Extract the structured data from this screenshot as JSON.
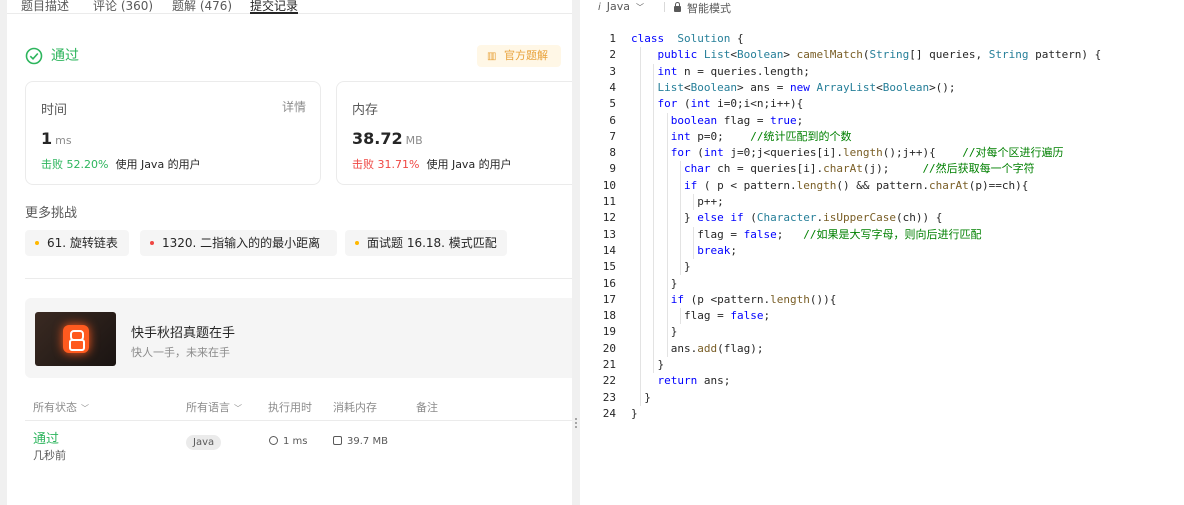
{
  "tabs": [
    {
      "label": "题目描述"
    },
    {
      "label": "评论 (360)"
    },
    {
      "label": "题解 (476)"
    },
    {
      "label": "提交记录"
    }
  ],
  "result": {
    "status": "通过",
    "official_solution": "官方题解",
    "time": {
      "label": "时间",
      "detail": "详情",
      "value": "1",
      "unit": "ms",
      "beat": "击败 52.20%",
      "beat_suffix": "使用 Java 的用户"
    },
    "memory": {
      "label": "内存",
      "value": "38.72",
      "unit": "MB",
      "beat": "击败 31.71%",
      "beat_suffix": "使用 Java 的用户"
    }
  },
  "more": {
    "title": "更多挑战",
    "items": [
      {
        "label": "61. 旋转链表",
        "color": "#ffb800"
      },
      {
        "label": "1320. 二指输入的的最小距离",
        "color": "#ef4743"
      },
      {
        "label": "面试题 16.18. 模式匹配",
        "color": "#ffb800"
      }
    ]
  },
  "banner": {
    "title": "快手秋招真题在手",
    "subtitle": "快人一手，未来在手"
  },
  "table": {
    "headers": {
      "status": "所有状态",
      "lang": "所有语言",
      "runtime": "执行用时",
      "memory": "消耗内存",
      "note": "备注"
    },
    "row": {
      "status": "通过",
      "time": "几秒前",
      "lang": "Java",
      "runtime": "1 ms",
      "memory": "39.7 MB"
    }
  },
  "editor": {
    "lang_icon": "i",
    "language": "Java",
    "mode": "智能模式",
    "lines": [
      [
        [
          "kw",
          "class"
        ],
        [
          "",
          "  "
        ],
        [
          "ty",
          "Solution"
        ],
        [
          "",
          " {"
        ]
      ],
      [
        [
          "",
          "    "
        ],
        [
          "kw",
          "public"
        ],
        [
          "",
          " "
        ],
        [
          "ty",
          "List"
        ],
        [
          "",
          "<"
        ],
        [
          "ty",
          "Boolean"
        ],
        [
          "",
          "> "
        ],
        [
          "fn",
          "camelMatch"
        ],
        [
          "",
          "("
        ],
        [
          "ty",
          "String"
        ],
        [
          "",
          "[] queries, "
        ],
        [
          "ty",
          "String"
        ],
        [
          "",
          " pattern) {"
        ]
      ],
      [
        [
          "",
          "    "
        ],
        [
          "kw",
          "int"
        ],
        [
          "",
          " n = queries.length;"
        ]
      ],
      [
        [
          "",
          "    "
        ],
        [
          "ty",
          "List"
        ],
        [
          "",
          "<"
        ],
        [
          "ty",
          "Boolean"
        ],
        [
          "",
          "> ans = "
        ],
        [
          "kw",
          "new"
        ],
        [
          "",
          " "
        ],
        [
          "ty",
          "ArrayList"
        ],
        [
          "",
          "<"
        ],
        [
          "ty",
          "Boolean"
        ],
        [
          "",
          ">();"
        ]
      ],
      [
        [
          "",
          "    "
        ],
        [
          "kw",
          "for"
        ],
        [
          "",
          " ("
        ],
        [
          "kw",
          "int"
        ],
        [
          "",
          " i=0;i<n;i++){"
        ]
      ],
      [
        [
          "",
          "      "
        ],
        [
          "kw",
          "boolean"
        ],
        [
          "",
          " flag = "
        ],
        [
          "kw",
          "true"
        ],
        [
          "",
          ";"
        ]
      ],
      [
        [
          "",
          "      "
        ],
        [
          "kw",
          "int"
        ],
        [
          "",
          " p=0;    "
        ],
        [
          "cm",
          "//统计匹配到的个数"
        ]
      ],
      [
        [
          "",
          "      "
        ],
        [
          "kw",
          "for"
        ],
        [
          "",
          " ("
        ],
        [
          "kw",
          "int"
        ],
        [
          "",
          " j=0;j<queries[i]."
        ],
        [
          "fn",
          "length"
        ],
        [
          "",
          "();j++){    "
        ],
        [
          "cm",
          "//对每个区进行遍历"
        ]
      ],
      [
        [
          "",
          "        "
        ],
        [
          "kw",
          "char"
        ],
        [
          "",
          " ch = queries[i]."
        ],
        [
          "fn",
          "charAt"
        ],
        [
          "",
          "(j);     "
        ],
        [
          "cm",
          "//然后获取每一个字符"
        ]
      ],
      [
        [
          "",
          "        "
        ],
        [
          "kw",
          "if"
        ],
        [
          "",
          " ( p < pattern."
        ],
        [
          "fn",
          "length"
        ],
        [
          "",
          "() && pattern."
        ],
        [
          "fn",
          "charAt"
        ],
        [
          "",
          "(p)==ch){"
        ]
      ],
      [
        [
          "",
          "          p++;"
        ]
      ],
      [
        [
          "",
          "        } "
        ],
        [
          "kw",
          "else"
        ],
        [
          "",
          " "
        ],
        [
          "kw",
          "if"
        ],
        [
          "",
          " ("
        ],
        [
          "ty",
          "Character"
        ],
        [
          "",
          "."
        ],
        [
          "fn",
          "isUpperCase"
        ],
        [
          "",
          "(ch)) {"
        ]
      ],
      [
        [
          "",
          "          flag = "
        ],
        [
          "kw",
          "false"
        ],
        [
          "",
          ";   "
        ],
        [
          "cm",
          "//如果是大写字母，则向后进行匹配"
        ]
      ],
      [
        [
          "",
          "          "
        ],
        [
          "kw",
          "break"
        ],
        [
          "",
          ";"
        ]
      ],
      [
        [
          "",
          "        }"
        ]
      ],
      [
        [
          "",
          "      }"
        ]
      ],
      [
        [
          "",
          "      "
        ],
        [
          "kw",
          "if"
        ],
        [
          "",
          " (p <pattern."
        ],
        [
          "fn",
          "length"
        ],
        [
          "",
          "()){"
        ]
      ],
      [
        [
          "",
          "        flag = "
        ],
        [
          "kw",
          "false"
        ],
        [
          "",
          ";"
        ]
      ],
      [
        [
          "",
          "      }"
        ]
      ],
      [
        [
          "",
          "      ans."
        ],
        [
          "fn",
          "add"
        ],
        [
          "",
          "(flag);"
        ]
      ],
      [
        [
          "",
          "    }"
        ]
      ],
      [
        [
          "",
          "    "
        ],
        [
          "kw",
          "return"
        ],
        [
          "",
          " ans;"
        ]
      ],
      [
        [
          "",
          "  }"
        ]
      ],
      [
        [
          "",
          "}"
        ]
      ]
    ]
  }
}
